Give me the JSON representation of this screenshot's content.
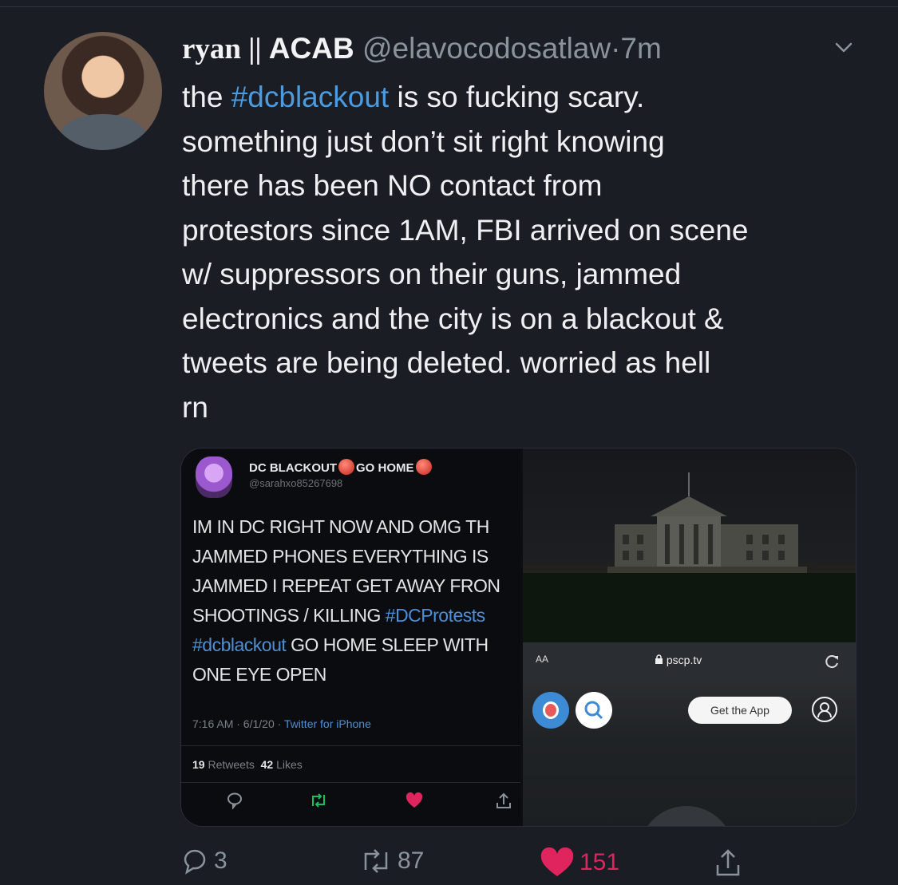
{
  "tweet": {
    "display_name": "ryan ||",
    "display_name_suffix": "ACAB",
    "handle": "@elavocodosatlaw",
    "separator": "·",
    "time": "7m",
    "text_lines": [
      {
        "pre": "the ",
        "tag": "#dcblackout",
        "post": " is so fucking scary."
      },
      {
        "pre": "something just don’t sit right knowing",
        "tag": "",
        "post": ""
      },
      {
        "pre": "there has been NO contact from",
        "tag": "",
        "post": ""
      },
      {
        "pre": "protestors since 1AM, FBI arrived on scene",
        "tag": "",
        "post": ""
      },
      {
        "pre": "w/ suppressors on their guns, jammed",
        "tag": "",
        "post": ""
      },
      {
        "pre": "electronics and the city is on a blackout &",
        "tag": "",
        "post": ""
      },
      {
        "pre": "tweets are being deleted. worried as hell",
        "tag": "",
        "post": ""
      },
      {
        "pre": "rn",
        "tag": "",
        "post": ""
      }
    ]
  },
  "embedded_tweet": {
    "name_part1": "DC BLACKOUT",
    "name_part2": "GO HOME",
    "handle": "@sarahxo85267698",
    "lines": [
      {
        "pre": "IM IN DC RIGHT NOW AND OMG TH",
        "tag": "",
        "post": ""
      },
      {
        "pre": "JAMMED PHONES EVERYTHING IS",
        "tag": "",
        "post": ""
      },
      {
        "pre": "JAMMED I REPEAT GET AWAY FRON",
        "tag": "",
        "post": ""
      },
      {
        "pre": "SHOOTINGS / KILLING ",
        "tag": "#DCProtests",
        "post": ""
      },
      {
        "pre": "",
        "tag": "#dcblackout",
        "post": " GO HOME SLEEP WITH"
      },
      {
        "pre": "ONE EYE OPEN",
        "tag": "",
        "post": ""
      }
    ],
    "timestamp": "7:16 AM · 6/1/20 · ",
    "source": "Twitter for iPhone",
    "retweets_count": "19",
    "retweets_label": "Retweets",
    "likes_count": "42",
    "likes_label": "Likes"
  },
  "browser": {
    "aa_label": "AA",
    "url": "pscp.tv",
    "get_app_label": "Get the App"
  },
  "actions": {
    "replies": "3",
    "retweets": "87",
    "likes": "151"
  },
  "colors": {
    "background": "#1a1d24",
    "hashtag": "#4a9bdf",
    "like": "#e0245e",
    "muted": "#8a939c"
  }
}
